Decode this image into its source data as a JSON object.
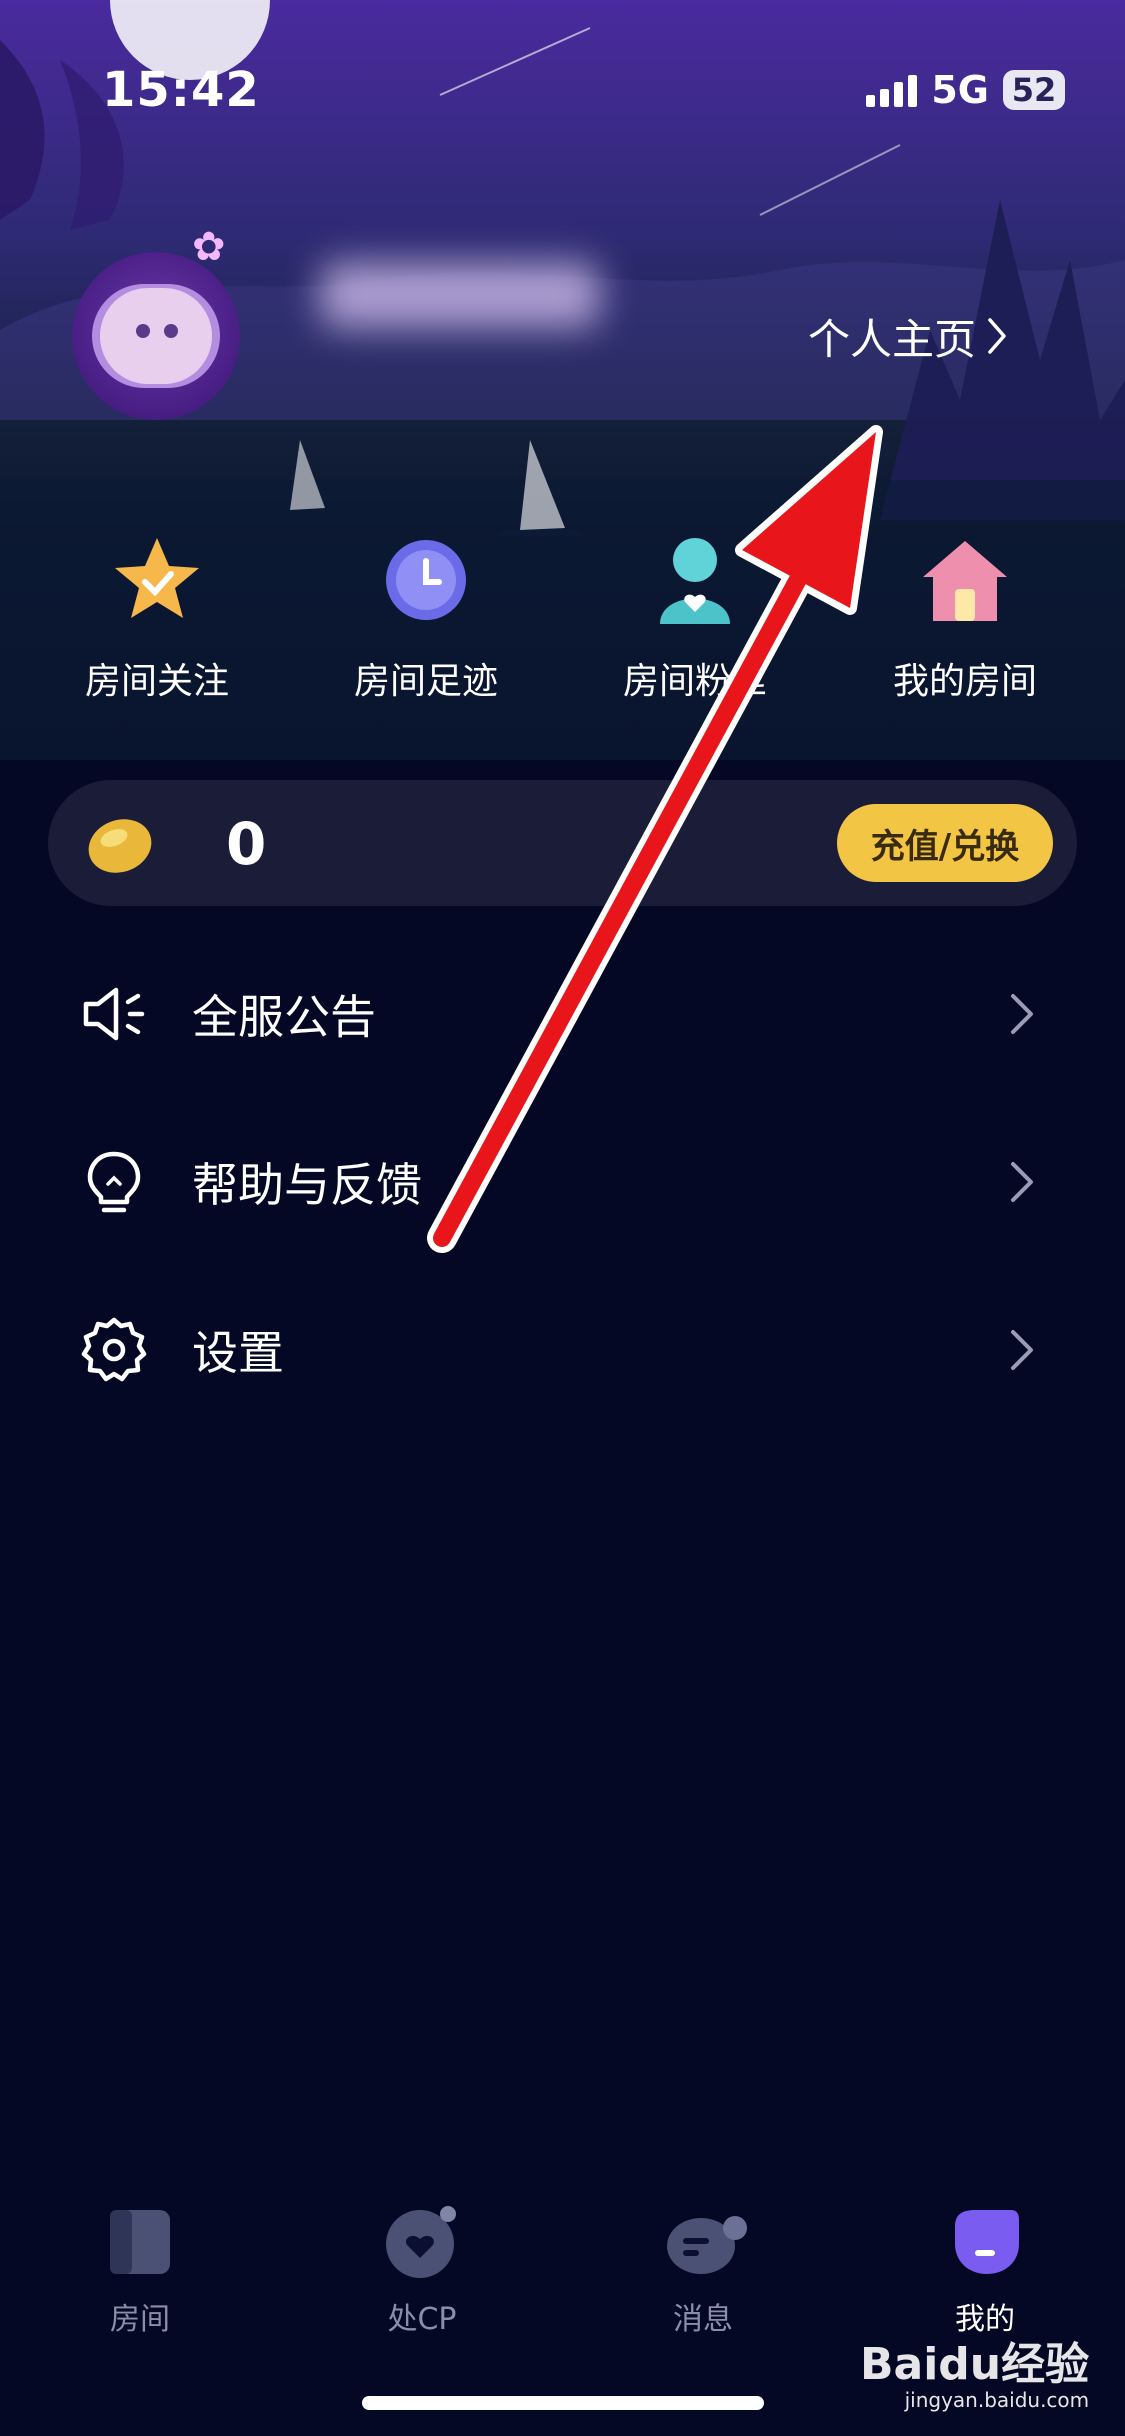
{
  "status_bar": {
    "time": "15:42",
    "network": "5G",
    "battery": "52"
  },
  "profile": {
    "link_label": "个人主页"
  },
  "quick_actions": [
    {
      "label": "房间关注",
      "icon": "star-check-icon"
    },
    {
      "label": "房间足迹",
      "icon": "clock-icon"
    },
    {
      "label": "房间粉丝",
      "icon": "person-heart-icon"
    },
    {
      "label": "我的房间",
      "icon": "house-icon"
    }
  ],
  "wallet": {
    "balance": "0",
    "recharge_label": "充值/兑换",
    "icon": "gold-bean-icon"
  },
  "menu": [
    {
      "label": "全服公告",
      "icon": "speaker-icon"
    },
    {
      "label": "帮助与反馈",
      "icon": "lightbulb-icon"
    },
    {
      "label": "设置",
      "icon": "gear-icon"
    }
  ],
  "tabs": [
    {
      "label": "房间",
      "icon": "room-door-icon"
    },
    {
      "label": "处CP",
      "icon": "heart-chat-icon"
    },
    {
      "label": "消息",
      "icon": "message-bubbles-icon"
    },
    {
      "label": "我的",
      "icon": "profile-face-icon",
      "active": true
    }
  ],
  "watermark": {
    "text": "Baidu经验",
    "sub": "jingyan.baidu.com"
  },
  "colors": {
    "accent": "#f2c545",
    "background": "#050824",
    "annotation_arrow": "#e8161b"
  }
}
